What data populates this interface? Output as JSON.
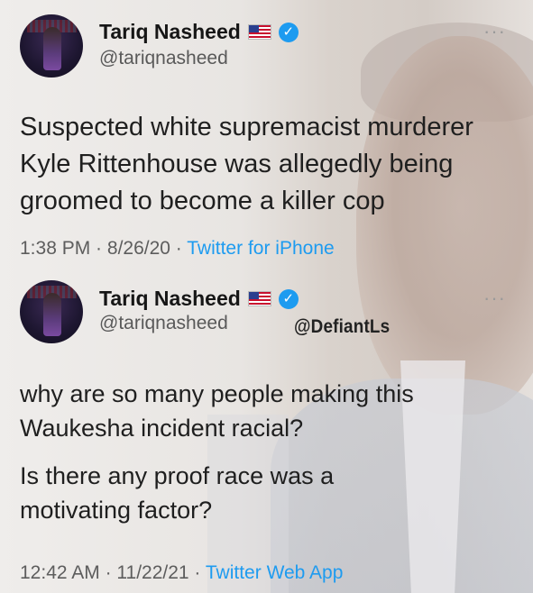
{
  "tweet1": {
    "display_name": "Tariq Nasheed",
    "handle": "@tariqnasheed",
    "text": "Suspected white supremacist murderer Kyle Rittenhouse was allegedly being groomed to become a killer cop",
    "time": "1:38 PM",
    "date": "8/26/20",
    "source": "Twitter for iPhone"
  },
  "tweet2": {
    "display_name": "Tariq Nasheed",
    "handle": "@tariqnasheed",
    "text_line1": "why are so many people making this Waukesha incident racial?",
    "text_line2": "Is there any proof race was a motivating factor?",
    "time": "12:42 AM",
    "date": "11/22/21",
    "source": "Twitter Web App"
  },
  "watermark": "@DefiantLs",
  "separator": " · ",
  "icons": {
    "verified": "verified-check-icon",
    "flag": "us-flag-icon",
    "more": "more-options-icon",
    "verified_glyph": "✓",
    "more_glyph": "···"
  },
  "colors": {
    "link": "#1d9bf0",
    "verified": "#1d9bf0",
    "secondary_text": "#5d5d5d"
  }
}
